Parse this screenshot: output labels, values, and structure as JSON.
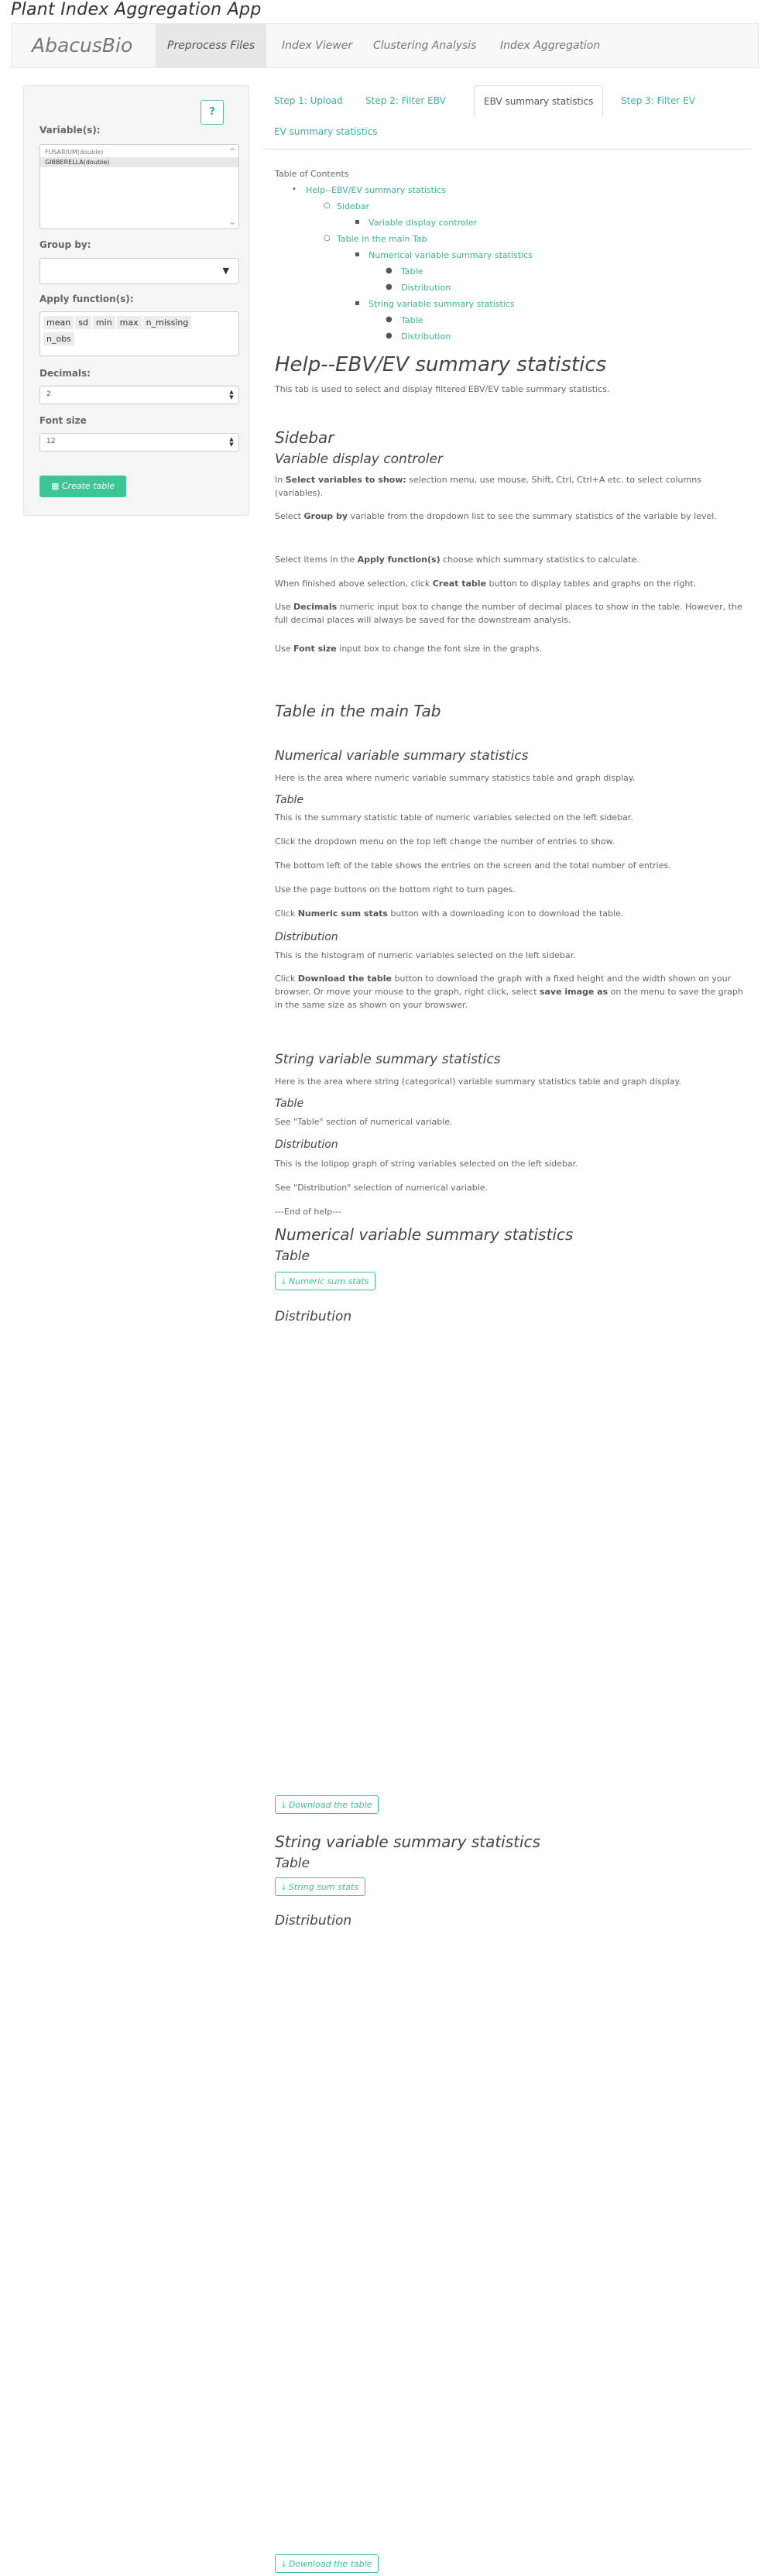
{
  "app": {
    "title": "Plant Index Aggregation App"
  },
  "navbar": {
    "brand": "AbacusBio",
    "items": [
      {
        "label": "Preprocess Files"
      },
      {
        "label": "Index Viewer"
      },
      {
        "label": "Clustering Analysis"
      },
      {
        "label": "Index Aggregation"
      }
    ]
  },
  "sidebar": {
    "help_label": "?",
    "variables_label": "Variable(s):",
    "variables": [
      "FUSARIUM(double)",
      "GIBBERELLA(double)"
    ],
    "groupby_label": "Group by:",
    "groupby_value": "",
    "functions_label": "Apply function(s):",
    "functions": [
      "mean",
      "sd",
      "min",
      "max",
      "n_missing",
      "n_obs"
    ],
    "decimals_label": "Decimals:",
    "decimals_value": "2",
    "fontsize_label": "Font size",
    "fontsize_value": "12",
    "create_label": "Create table"
  },
  "tabs": [
    {
      "label": "Step 1: Upload"
    },
    {
      "label": "Step 2: Filter EBV"
    },
    {
      "label": "EBV summary statistics"
    },
    {
      "label": "Step 3: Filter EV"
    },
    {
      "label": "EV summary statistics"
    }
  ],
  "toc": {
    "heading": "Table of Contents",
    "items": [
      "Help--EBV/EV summary statistics",
      "Sidebar",
      "Variable display controler",
      "Table in the main Tab",
      "Numerical variable summary statistics",
      "Table",
      "Distribution",
      "String variable summary statistics",
      "Table",
      "Distribution"
    ]
  },
  "help": {
    "title": "Help--EBV/EV summary statistics",
    "intro": "This tab is used to select and display filtered EBV/EV table summary statistics.",
    "sidebar_title": "Sidebar",
    "controler_title": "Variable display controler",
    "p1_a": "In ",
    "p1_b": "Select variables to show:",
    "p1_c": " selection menu, use mouse, Shift, Ctrl, Ctrl+A etc. to select columns (variables).",
    "p2_a": "Select ",
    "p2_b": "Group by",
    "p2_c": " variable from the dropdown list to see the summary statistics of the variable by level.",
    "p3_a": "Select items in the ",
    "p3_b": "Apply function(s)",
    "p3_c": " choose which summary statistics to calculate.",
    "p4_a": "When finished above selection, click ",
    "p4_b": "Creat table",
    "p4_c": " button to display tables and graphs on the right.",
    "p5_a": "Use ",
    "p5_b": "Decimals",
    "p5_c": " numeric input box to change the number of decimal places to show in the table. However, the full decimal places will always be saved for the downstream analysis.",
    "p6_a": "Use ",
    "p6_b": "Font size",
    "p6_c": " input box to change the font size in the graphs.",
    "main_title": "Table in the main Tab",
    "num_title": "Numerical variable summary statistics",
    "num_intro": "Here is the area where numeric variable summary statistics table and graph display.",
    "table_title": "Table",
    "t1": "This is the summary statistic table of numeric variables selected on the left sidebar.",
    "t2": "Click the dropdown menu on the top left change the number of entries to show.",
    "t3": "The bottom left of the table shows the entries on the screen and the total number of entries.",
    "t4": "Use the page buttons on the bottom right to turn pages.",
    "t5_a": "Click ",
    "t5_b": "Numeric sum stats",
    "t5_c": " button with a downloading icon to download the table.",
    "dist_title": "Distribution",
    "d1": "This is the histogram of numeric variables selected on the left sidebar.",
    "d2_a": "Click ",
    "d2_b": "Download the table",
    "d2_c": " button to download the graph with a fixed height and the width shown on your browser. Or move your mouse to the graph, right click, select ",
    "d2_d": "save image as",
    "d2_e": " on the menu to save the graph in the same size as shown on your browswer.",
    "str_title": "String variable summary statistics",
    "str_intro": "Here is the area where string (categorical) variable summary statistics table and graph display.",
    "s_table_title": "Table",
    "s_table_text": "See \"Table\" section of numerical variable.",
    "s_dist_title": "Distribution",
    "s_d1": "This is the lolipop graph of string variables selected on the left sidebar.",
    "s_d2": "See \"Distribution\" selection of numerical variable.",
    "end": "---End of help---"
  },
  "output": {
    "num_title": "Numerical variable summary statistics",
    "num_table_title": "Table",
    "num_btn": "Numeric sum stats",
    "num_dist_title": "Distribution",
    "num_download": "Download the table",
    "str_title": "String variable summary statistics",
    "str_table_title": "Table",
    "str_btn": "String sum stats",
    "str_dist_title": "Distribution",
    "str_download": "Download the table"
  }
}
